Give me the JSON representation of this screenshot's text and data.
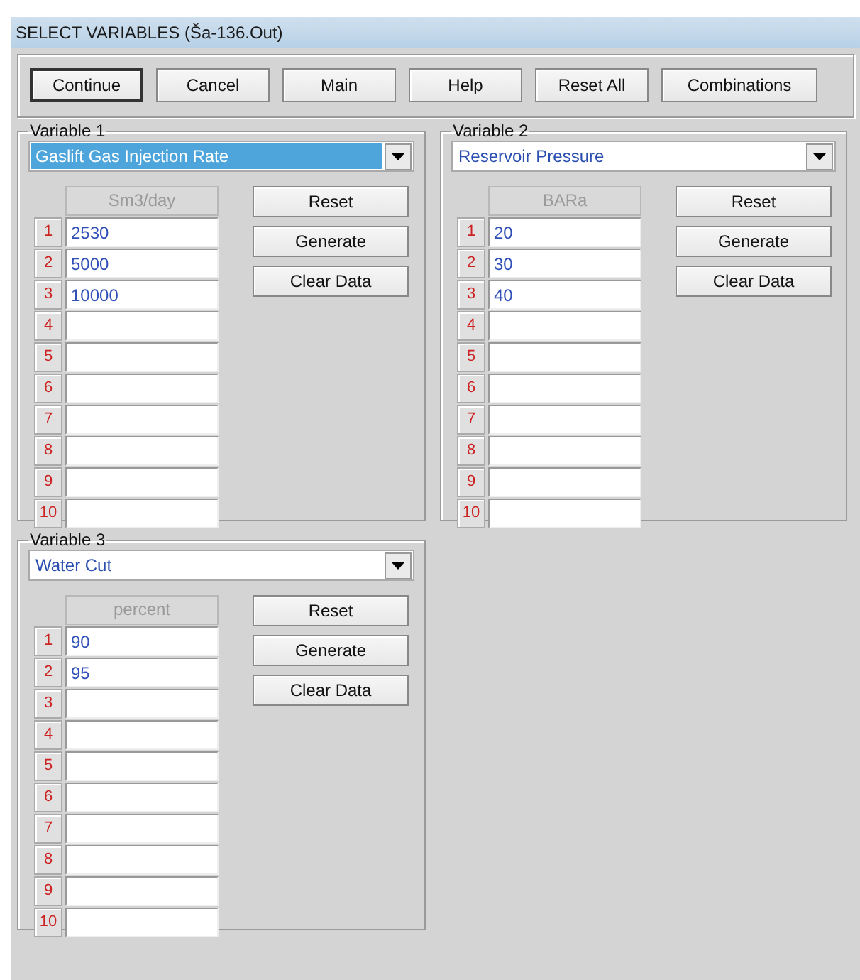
{
  "window": {
    "title": "SELECT VARIABLES (Ša-136.Out)"
  },
  "toolbar": [
    {
      "label": "Continue",
      "default": true
    },
    {
      "label": "Cancel",
      "default": false
    },
    {
      "label": "Main",
      "default": false
    },
    {
      "label": "Help",
      "default": false
    },
    {
      "label": "Reset All",
      "default": false
    },
    {
      "label": "Combinations",
      "default": false
    }
  ],
  "variables": [
    {
      "label": "Variable 1",
      "value": "Gaslift Gas Injection Rate",
      "focused": true,
      "unit": "Sm3/day",
      "buttons": [
        "Reset",
        "Generate",
        "Clear Data"
      ],
      "rows": [
        {
          "number": "1",
          "value": "2530"
        },
        {
          "number": "2",
          "value": "5000"
        },
        {
          "number": "3",
          "value": "10000"
        },
        {
          "number": "4"
        },
        {
          "number": "5"
        },
        {
          "number": "6"
        },
        {
          "number": "7"
        },
        {
          "number": "8"
        },
        {
          "number": "9"
        },
        {
          "number": "10"
        }
      ]
    },
    {
      "label": "Variable 2",
      "value": "Reservoir Pressure",
      "focused": false,
      "unit": "BARa",
      "buttons": [
        "Reset",
        "Generate",
        "Clear Data"
      ],
      "rows": [
        {
          "number": "1",
          "value": "20"
        },
        {
          "number": "2",
          "value": "30"
        },
        {
          "number": "3",
          "value": "40"
        },
        {
          "number": "4"
        },
        {
          "number": "5"
        },
        {
          "number": "6"
        },
        {
          "number": "7"
        },
        {
          "number": "8"
        },
        {
          "number": "9"
        },
        {
          "number": "10"
        }
      ]
    },
    {
      "label": "Variable 3",
      "value": "Water Cut",
      "focused": false,
      "unit": "percent",
      "buttons": [
        "Reset",
        "Generate",
        "Clear Data"
      ],
      "rows": [
        {
          "number": "1",
          "value": "90"
        },
        {
          "number": "2",
          "value": "95"
        },
        {
          "number": "3"
        },
        {
          "number": "4"
        },
        {
          "number": "5"
        },
        {
          "number": "6"
        },
        {
          "number": "7"
        },
        {
          "number": "8"
        },
        {
          "number": "9"
        },
        {
          "number": "10"
        }
      ]
    }
  ]
}
